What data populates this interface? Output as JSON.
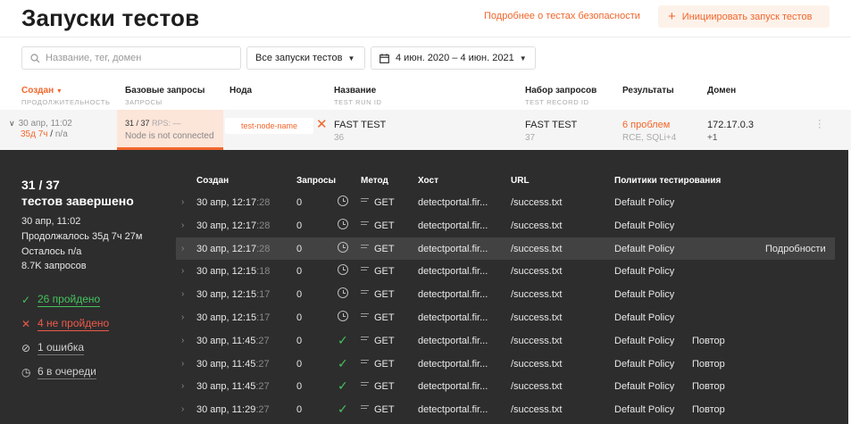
{
  "header": {
    "title": "Запуски тестов",
    "security_link": "Подробнее о тестах безопасности",
    "init_button": "Инициировать запуск тестов"
  },
  "filters": {
    "search_placeholder": "Название, тег, домен",
    "runs_filter": "Все запуски тестов",
    "date_range": "4 июн. 2020 – 4 июн. 2021"
  },
  "columns": {
    "created": {
      "label": "Создан",
      "sub": "Продолжительность"
    },
    "base": {
      "label": "Базовые запросы",
      "sub": "Запросы"
    },
    "node": {
      "label": "Нода"
    },
    "name": {
      "label": "Название",
      "sub": "Test run ID"
    },
    "request_set": {
      "label": "Набор запросов",
      "sub": "Test record ID"
    },
    "results": {
      "label": "Результаты"
    },
    "domain": {
      "label": "Домен"
    }
  },
  "run": {
    "created": "30 апр, 11:02",
    "duration": "35д 7ч",
    "duration_sep": "/",
    "remaining": "n/a",
    "base_count": "31 / 37",
    "rps": "RPS: —",
    "node_status": "Node is not connected",
    "node_name": "test-node-name",
    "name": "FAST TEST",
    "run_id": "36",
    "request_set": "FAST TEST",
    "record_id": "37",
    "results": "6 проблем",
    "results_detail": "RCE, SQLi+4",
    "domain": "172.17.0.3",
    "domain_extra": "+1"
  },
  "summary": {
    "count": "31 / 37",
    "title": "тестов завершено",
    "started": "30 апр, 11:02",
    "lasted": "Продолжалось 35д 7ч 27м",
    "remaining": "Осталось n/a",
    "requests": "8.7K запросов",
    "passed": "26 пройдено",
    "failed": "4 не пройдено",
    "errors": "1 ошибка",
    "queued": "6 в очереди"
  },
  "detail_columns": {
    "created": "Создан",
    "requests": "Запросы",
    "method": "Метод",
    "host": "Хост",
    "url": "URL",
    "policy": "Политики тестирования"
  },
  "detail_rows": [
    {
      "time": "30 апр, 12:17",
      "sec": ":28",
      "requests": "0",
      "status": "clock",
      "method": "GET",
      "host": "detectportal.fir...",
      "url": "/success.txt",
      "policy": "Default Policy",
      "retry": "",
      "details": ""
    },
    {
      "time": "30 апр, 12:17",
      "sec": ":28",
      "requests": "0",
      "status": "clock",
      "method": "GET",
      "host": "detectportal.fir...",
      "url": "/success.txt",
      "policy": "Default Policy",
      "retry": "",
      "details": ""
    },
    {
      "time": "30 апр, 12:17",
      "sec": ":28",
      "requests": "0",
      "status": "clock",
      "method": "GET",
      "host": "detectportal.fir...",
      "url": "/success.txt",
      "policy": "Default Policy",
      "retry": "",
      "details": "Подробности"
    },
    {
      "time": "30 апр, 12:15",
      "sec": ":18",
      "requests": "0",
      "status": "clock",
      "method": "GET",
      "host": "detectportal.fir...",
      "url": "/success.txt",
      "policy": "Default Policy",
      "retry": "",
      "details": ""
    },
    {
      "time": "30 апр, 12:15",
      "sec": ":17",
      "requests": "0",
      "status": "clock",
      "method": "GET",
      "host": "detectportal.fir...",
      "url": "/success.txt",
      "policy": "Default Policy",
      "retry": "",
      "details": ""
    },
    {
      "time": "30 апр, 12:15",
      "sec": ":17",
      "requests": "0",
      "status": "clock",
      "method": "GET",
      "host": "detectportal.fir...",
      "url": "/success.txt",
      "policy": "Default Policy",
      "retry": "",
      "details": ""
    },
    {
      "time": "30 апр, 11:45",
      "sec": ":27",
      "requests": "0",
      "status": "check",
      "method": "GET",
      "host": "detectportal.fir...",
      "url": "/success.txt",
      "policy": "Default Policy",
      "retry": "Повтор",
      "details": ""
    },
    {
      "time": "30 апр, 11:45",
      "sec": ":27",
      "requests": "0",
      "status": "check",
      "method": "GET",
      "host": "detectportal.fir...",
      "url": "/success.txt",
      "policy": "Default Policy",
      "retry": "Повтор",
      "details": ""
    },
    {
      "time": "30 апр, 11:45",
      "sec": ":27",
      "requests": "0",
      "status": "check",
      "method": "GET",
      "host": "detectportal.fir...",
      "url": "/success.txt",
      "policy": "Default Policy",
      "retry": "Повтор",
      "details": ""
    },
    {
      "time": "30 апр, 11:29",
      "sec": ":27",
      "requests": "0",
      "status": "check",
      "method": "GET",
      "host": "detectportal.fir...",
      "url": "/success.txt",
      "policy": "Default Policy",
      "retry": "Повтор",
      "details": ""
    }
  ],
  "highlighted_row": 2,
  "colors": {
    "accent": "#f2662b",
    "pass": "#45c35d",
    "fail": "#ee5a4b",
    "panel": "#2d2d2d"
  },
  "icons": [
    "search-icon",
    "calendar-icon",
    "chevron-down-icon",
    "plus-icon",
    "close-icon",
    "kebab-icon",
    "clock-icon",
    "check-icon",
    "method-icon",
    "chevron-right-icon",
    "error-icon",
    "queue-clock-icon"
  ]
}
